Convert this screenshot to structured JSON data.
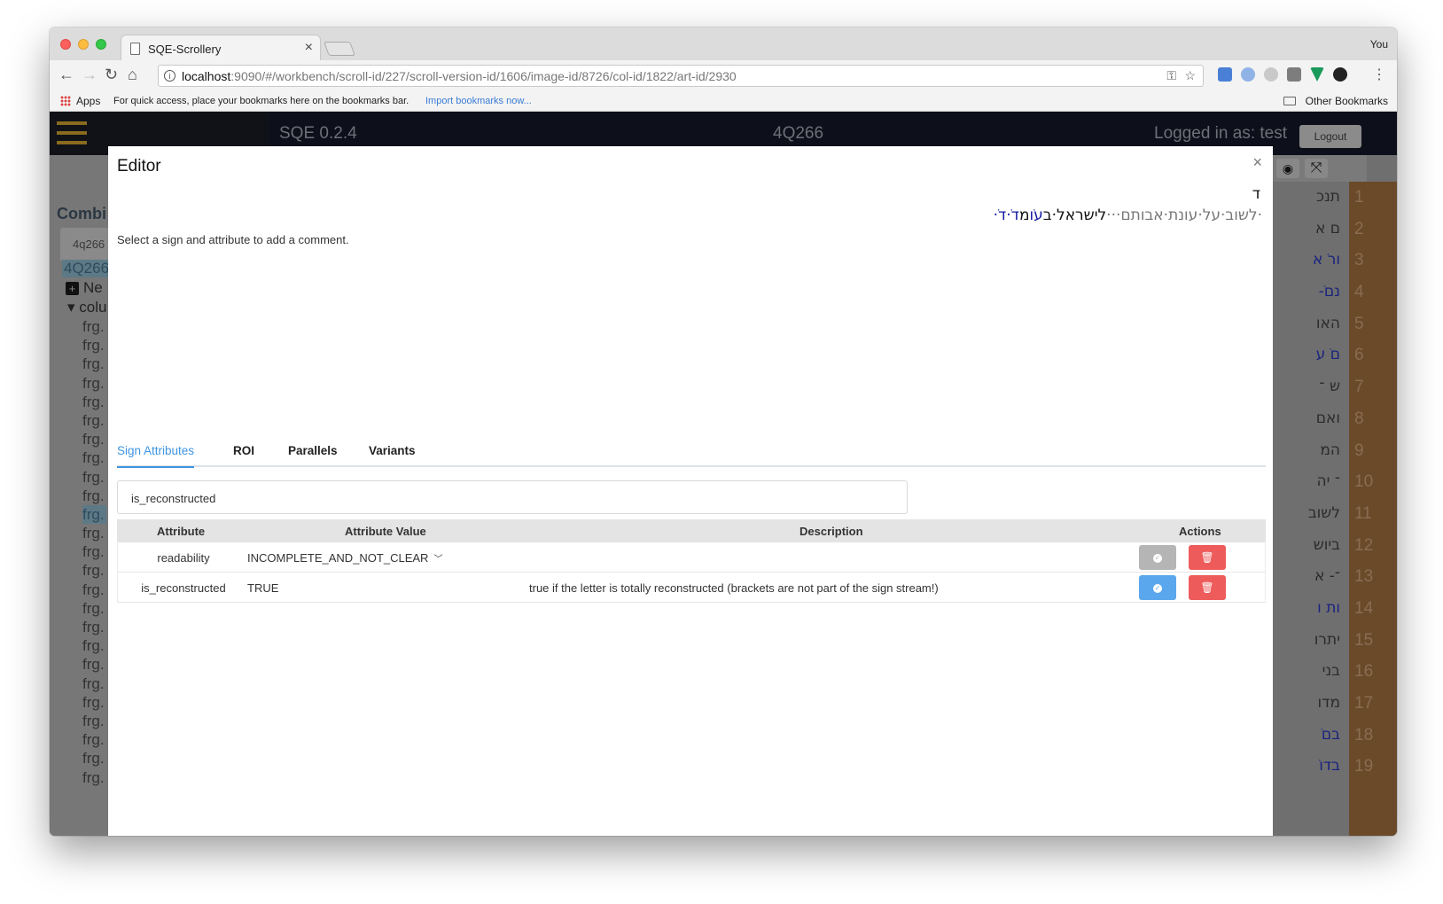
{
  "browser": {
    "tab_title": "SQE-Scrollery",
    "tab_close": "×",
    "profile": "You",
    "url_host": "localhost",
    "url_rest": ":9090/#/workbench/scroll-id/227/scroll-version-id/1606/image-id/8726/col-id/1822/art-id/2930",
    "bookmarks": {
      "apps": "Apps",
      "hint": "For quick access, place your bookmarks here on the bookmarks bar.",
      "import": "Import bookmarks now...",
      "other": "Other Bookmarks"
    }
  },
  "app": {
    "version": "SQE 0.2.4",
    "scroll_name": "4Q266",
    "logged_in": "Logged in as: test",
    "logout": "Logout"
  },
  "sidebar": {
    "title": "Combi",
    "search_value": "4q266",
    "active_item": "4Q266",
    "new_item": "Ne",
    "column_item": "colu",
    "fragments": [
      "frg.",
      "frg.",
      "frg.",
      "frg.",
      "frg.",
      "frg.",
      "frg.",
      "frg.",
      "frg.",
      "frg.",
      "frg.",
      "frg.",
      "frg.",
      "frg.",
      "frg.",
      "frg.",
      "frg.",
      "frg.",
      "frg.",
      "frg.",
      "frg.",
      "frg.",
      "frg.",
      "frg.",
      "frg."
    ],
    "highlighted_index": 10
  },
  "right_column": {
    "lines": [
      "תנכ",
      "ם א",
      "ורֹ א",
      "נםֹ-",
      "האו",
      "םֹ ע",
      "ש ־",
      "ואם",
      "המ",
      "־ יה",
      "לשוב",
      "ביוש",
      "־- א",
      "ות ו",
      "יתרו",
      "בני",
      "מדו",
      "בםֹ",
      "בדוֹ"
    ],
    "blue_lines": [
      2,
      3,
      5,
      13,
      17,
      18
    ],
    "numbers": [
      "1",
      "2",
      "3",
      "4",
      "5",
      "6",
      "7",
      "8",
      "9",
      "10",
      "11",
      "12",
      "13",
      "14",
      "15",
      "16",
      "17",
      "18",
      "19"
    ]
  },
  "editor": {
    "title": "Editor",
    "close": "×",
    "selected_sign": "ד",
    "transcript": {
      "grey": "·לשוב·על·עונת·אבותם···",
      "black": "לישראל·ב",
      "blue_a": "עֹו",
      "black_b": "מ",
      "blue_b": "דֹ·דֹ·"
    },
    "hint": "Select a sign and attribute to add a comment.",
    "tabs": [
      "Sign Attributes",
      "ROI",
      "Parallels",
      "Variants"
    ],
    "active_tab": "Sign Attributes",
    "attribute_input": "is_reconstructed",
    "table": {
      "headers": [
        "Attribute",
        "Attribute Value",
        "Description",
        "Actions"
      ],
      "rows": [
        {
          "attribute": "readability",
          "value": "INCOMPLETE_AND_NOT_CLEAR",
          "description": "",
          "has_dropdown": true
        },
        {
          "attribute": "is_reconstructed",
          "value": "TRUE",
          "description": "true if the letter is totally reconstructed (brackets are not part of the sign stream!)",
          "has_dropdown": false
        }
      ]
    }
  },
  "colors": {
    "accent": "#3e95e2",
    "danger": "#ee5b5b",
    "confirm": "#5ba7ee",
    "disabled": "#b5b5b5"
  },
  "icons": [
    "back-arrow-icon",
    "forward-arrow-icon",
    "reload-icon",
    "home-icon",
    "info-icon",
    "key-icon",
    "star-icon",
    "menu-dots-icon",
    "eye-icon",
    "expand-icon",
    "check-icon",
    "trash-icon",
    "chevron-down-icon",
    "hamburger-icon",
    "plus-icon",
    "folder-icon"
  ]
}
